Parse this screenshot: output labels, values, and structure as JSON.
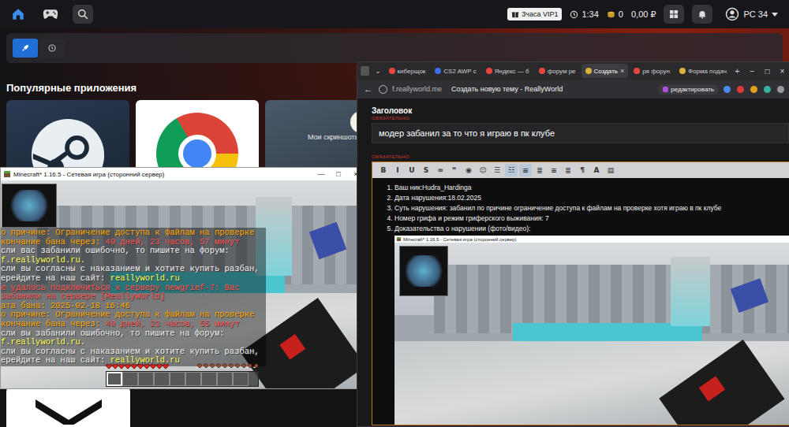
{
  "launcher": {
    "nav": [
      {
        "kind": "home",
        "selected": true
      },
      {
        "kind": "gamepad",
        "selected": false
      },
      {
        "kind": "search",
        "selected": false
      }
    ],
    "vip_badge": "3часа VIP1",
    "time": "1:34",
    "coins": "0",
    "balance": "0,00 ₽",
    "user": "PC 34",
    "view_toggle": [
      {
        "kind": "rocket",
        "selected": true
      },
      {
        "kind": "history",
        "selected": false
      }
    ],
    "section_title": "Популярные приложения",
    "apps": [
      {
        "kind": "steam",
        "label": ""
      },
      {
        "kind": "chrome",
        "label": ""
      },
      {
        "kind": "screenshots",
        "label": "Мои скриншоты"
      }
    ]
  },
  "minecraft_window": {
    "title": "Minecraft* 1.16.5 - Сетевая игра (сторонний сервер)",
    "controls": [
      "—",
      "□",
      "×"
    ],
    "chat": [
      [
        {
          "text": "о причине: Ограничение доступа к файлам на проверке",
          "color": "#ffaa00"
        }
      ],
      [
        {
          "text": "кончание бана через: ",
          "color": "#ffaa00"
        },
        {
          "text": "49 дней, 23 часов, 57 минут",
          "color": "#ff5555"
        }
      ],
      [
        {
          "text": "сли вас забанили ошибочно, то пишите на форум:",
          "color": "#f2f2f2"
        }
      ],
      [
        {
          "text": "f.reallyworld.ru.",
          "color": "#ffff55"
        }
      ],
      [
        {
          "text": "сли вы согласны с наказанием и хотите купить разбан,",
          "color": "#f2f2f2"
        }
      ],
      [
        {
          "text": "ерейдите на наш сайт: ",
          "color": "#f2f2f2"
        },
        {
          "text": "reallyworld.ru",
          "color": "#ffff55"
        }
      ],
      [
        {
          "text": "е удалось подключиться к серверу newgrief-7: Вас",
          "color": "#ff5555"
        }
      ],
      [
        {
          "text": "забанили на сервере [ReallyWorld]",
          "color": "#ff5555"
        }
      ],
      [
        {
          "text": "ата бана: 2025-02-18 16:46",
          "color": "#ffaa00"
        }
      ],
      [
        {
          "text": "о причине: Ограничение доступа к файлам на проверке",
          "color": "#ffaa00"
        }
      ],
      [
        {
          "text": "кончание бана через: ",
          "color": "#ffaa00"
        },
        {
          "text": "49 дней, 23 часов, 55 минут",
          "color": "#ff5555"
        }
      ],
      [
        {
          "text": "сли вы забанили ошибочно, то пишите на форум:",
          "color": "#f2f2f2"
        }
      ],
      [
        {
          "text": "f.reallyworld.ru.",
          "color": "#ffff55"
        }
      ],
      [
        {
          "text": "сли вы согласны с наказанием и хотите купить разбан,",
          "color": "#f2f2f2"
        }
      ],
      [
        {
          "text": "ерейдите на наш сайт: ",
          "color": "#f2f2f2"
        },
        {
          "text": "reallyworld.ru",
          "color": "#ffff55"
        }
      ]
    ],
    "health_hearts": 10,
    "food": 10,
    "hotbar": [
      {
        "selected": true
      },
      {
        "selected": false
      },
      {
        "selected": false
      },
      {
        "selected": false
      },
      {
        "selected": false
      },
      {
        "selected": false
      },
      {
        "selected": false
      },
      {
        "selected": false
      },
      {
        "selected": false
      }
    ]
  },
  "browser": {
    "menu_caret": "⌄",
    "tabs": [
      {
        "label": "киберщок",
        "selected": false,
        "color": "#e8453c"
      },
      {
        "label": "CS2 AWP с",
        "selected": false,
        "color": "#3c6fe8"
      },
      {
        "label": "Яндекс — б",
        "selected": false,
        "color": "#e8453c"
      },
      {
        "label": "форум ре",
        "selected": false,
        "color": "#e8453c"
      },
      {
        "label": "Создать",
        "selected": true,
        "color": "#d8b23a"
      },
      {
        "label": "ря форун",
        "selected": false,
        "color": "#e8453c"
      },
      {
        "label": "Форма подач",
        "selected": false,
        "color": "#d8b23a"
      }
    ],
    "tab_close": "×",
    "new_tab": "+",
    "controls": [
      "−",
      "□",
      "×"
    ],
    "back": "←",
    "url": "f.reallyworld.me",
    "page_title": "Создать новую тему - ReallyWorld",
    "ext_label": "редактировать",
    "form": {
      "title_label": "Заголовок",
      "required": "ОБЯЗАТЕЛЬНО",
      "title_value": "модер забанил за то что я играю в пк клубе",
      "body_required": "ОБЯЗАТЕЛЬНО",
      "toolbar": [
        {
          "label": "B",
          "selected": false
        },
        {
          "label": "I",
          "selected": false
        },
        {
          "label": "U",
          "selected": false
        },
        {
          "label": "S",
          "selected": false
        },
        {
          "label": "∞",
          "selected": false
        },
        {
          "label": "❞",
          "selected": false
        },
        {
          "label": "◉",
          "selected": false
        },
        {
          "label": "☺",
          "selected": false
        },
        {
          "label": "☰",
          "selected": false
        },
        {
          "label": "☷",
          "selected": true
        },
        {
          "label": "≡",
          "selected": true
        },
        {
          "label": "≣",
          "selected": false
        },
        {
          "label": "≡",
          "selected": false
        },
        {
          "label": "≣",
          "selected": false
        },
        {
          "label": "¶",
          "selected": false
        },
        {
          "label": "A",
          "selected": false
        },
        {
          "label": "▤",
          "selected": false
        }
      ],
      "items": [
        "Ваш ник:Hudra_Hardinga",
        "Дата нарушения:18.02.2025",
        "Суть нарушения: забанил по причине ограничение доступа к файлам на проверке хотя играю в пк клубе",
        "Номер грифа и режим гриферского выживания: 7",
        "Доказательства о нарушении (фото/видео):"
      ],
      "proof_image": {
        "title": "Minecraft* 1.16.5 - Сетевая игра (сторонний сервер)"
      }
    }
  }
}
